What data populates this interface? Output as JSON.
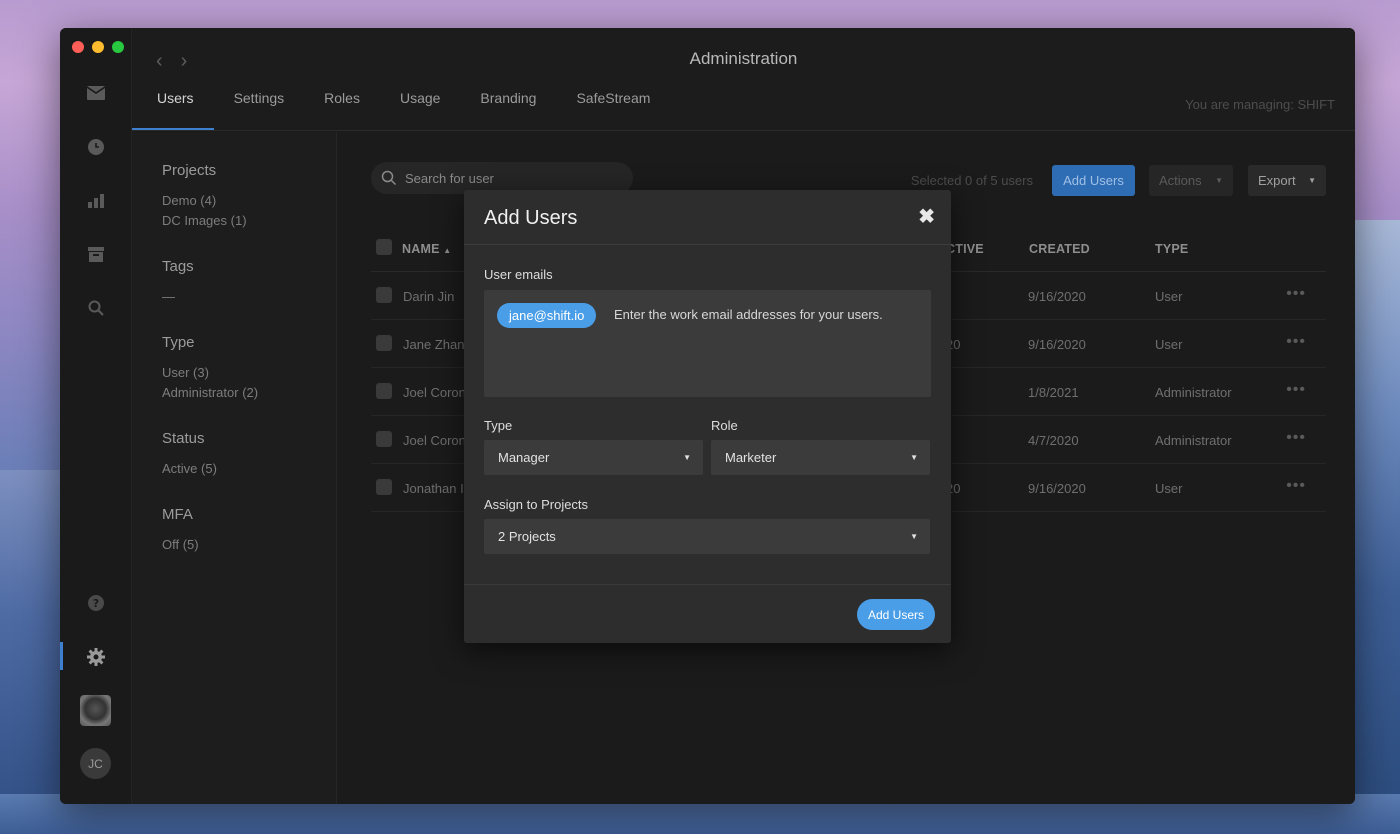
{
  "window": {
    "title": "Administration"
  },
  "tabs": [
    {
      "label": "Users"
    },
    {
      "label": "Settings"
    },
    {
      "label": "Roles"
    },
    {
      "label": "Usage"
    },
    {
      "label": "Branding"
    },
    {
      "label": "SafeStream"
    }
  ],
  "managing": "You are managing: SHIFT",
  "filters": {
    "projects": {
      "title": "Projects",
      "items": [
        "Demo (4)",
        "DC Images (1)"
      ]
    },
    "tags": {
      "title": "Tags",
      "items": [
        "—"
      ]
    },
    "type": {
      "title": "Type",
      "items": [
        "User (3)",
        "Administrator (2)"
      ]
    },
    "status": {
      "title": "Status",
      "items": [
        "Active (5)"
      ]
    },
    "mfa": {
      "title": "MFA",
      "items": [
        "Off (5)"
      ]
    }
  },
  "toolbar": {
    "search_placeholder": "Search for user",
    "selected": "Selected 0 of 5 users",
    "add_users": "Add Users",
    "actions": "Actions",
    "export": "Export"
  },
  "table": {
    "headers": {
      "name": "NAME",
      "last_active": "CTIVE",
      "created": "CREATED",
      "type": "TYPE"
    },
    "rows": [
      {
        "name": "Darin Jin",
        "last_active": "",
        "created": "9/16/2020",
        "type": "User"
      },
      {
        "name": "Jane Zhan",
        "last_active": "20",
        "created": "9/16/2020",
        "type": "User"
      },
      {
        "name": "Joel Coron",
        "last_active": "",
        "created": "1/8/2021",
        "type": "Administrator"
      },
      {
        "name": "Joel Coron",
        "last_active": "",
        "created": "4/7/2020",
        "type": "Administrator"
      },
      {
        "name": "Jonathan I",
        "last_active": "20",
        "created": "9/16/2020",
        "type": "User"
      }
    ]
  },
  "modal": {
    "title": "Add Users",
    "close": "✖",
    "emails_label": "User emails",
    "email_chip": "jane@shift.io",
    "email_hint": "Enter the work email addresses for your users.",
    "type_label": "Type",
    "type_value": "Manager",
    "role_label": "Role",
    "role_value": "Marketer",
    "projects_label": "Assign to Projects",
    "projects_value": "2 Projects",
    "submit": "Add Users"
  },
  "user": {
    "initials": "JC"
  },
  "colors": {
    "accent": "#4a9ee8",
    "accent_dark": "#2e6cb3",
    "background": "#1b1b1b",
    "modal": "#2d2d2d"
  }
}
